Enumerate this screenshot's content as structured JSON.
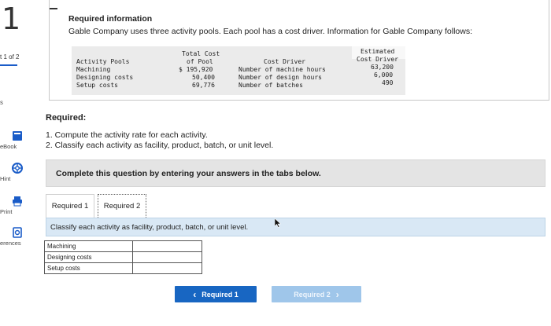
{
  "sidebar": {
    "question_number": "1",
    "part_of": "t 1 of 2",
    "side_fragment": "s",
    "items": [
      {
        "label": "eBook",
        "icon": "book-icon"
      },
      {
        "label": "Hint",
        "icon": "lifebuoy-icon"
      },
      {
        "label": "Print",
        "icon": "printer-icon"
      },
      {
        "label": "erences",
        "icon": "references-icon"
      }
    ]
  },
  "info": {
    "title": "Required information",
    "text": "Gable Company uses three activity pools. Each pool has a cost driver. Information for Gable Company follows:",
    "table": {
      "col_pools_header": "Activity Pools",
      "col_cost_header_1": "Total Cost",
      "col_cost_header_2": "of Pool",
      "col_driver_header": "Cost Driver",
      "col_est_header_1": "Estimated",
      "col_est_header_2": "Cost Driver",
      "rows": [
        {
          "pool": "Machining",
          "cost": "$ 195,920",
          "driver": "Number of machine hours",
          "estimate": "63,200"
        },
        {
          "pool": "Designing costs",
          "cost": "50,400",
          "driver": "Number of design hours",
          "estimate": "6,000"
        },
        {
          "pool": "Setup costs",
          "cost": "69,776",
          "driver": "Number of batches",
          "estimate": "490"
        }
      ]
    }
  },
  "required": {
    "title": "Required:",
    "items": [
      "1. Compute the activity rate for each activity.",
      "2. Classify each activity as facility, product, batch, or unit level."
    ]
  },
  "banner": {
    "text": "Complete this question by entering your answers in the tabs below."
  },
  "tabs": [
    {
      "label": "Required 1"
    },
    {
      "label": "Required 2"
    }
  ],
  "task": {
    "text": "Classify each activity as facility, product, batch, or unit level."
  },
  "answer_rows": [
    {
      "label": "Machining",
      "value": ""
    },
    {
      "label": "Designing costs",
      "value": ""
    },
    {
      "label": "Setup costs",
      "value": ""
    }
  ],
  "nav": {
    "prev_label": "Required 1",
    "next_label": "Required 2",
    "prev_glyph": "‹",
    "next_glyph": "›"
  },
  "colors": {
    "accent": "#1866c2",
    "disabled": "#9fc6ea",
    "task_bar": "#d9e8f5"
  }
}
